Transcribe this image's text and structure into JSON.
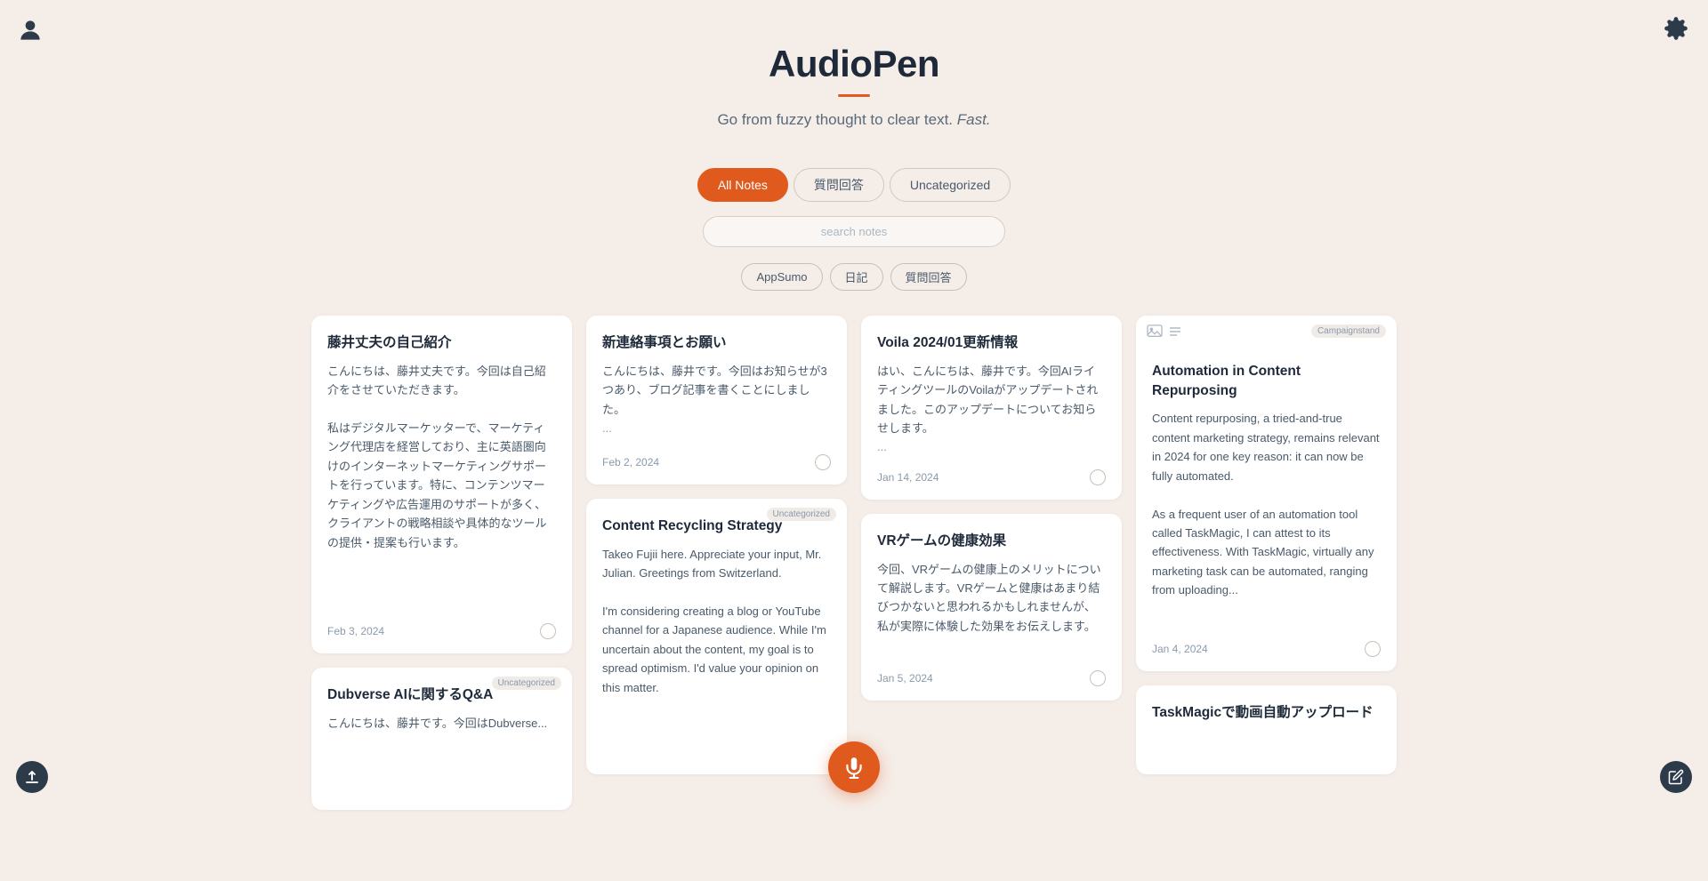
{
  "app": {
    "title": "AudioPen",
    "subtitle_normal": "Go from fuzzy thought to clear text.",
    "subtitle_italic": "Fast.",
    "divider_color": "#e05a1e"
  },
  "tabs": [
    {
      "id": "all",
      "label": "All Notes",
      "active": true
    },
    {
      "id": "qa",
      "label": "質問回答",
      "active": false
    },
    {
      "id": "uncategorized",
      "label": "Uncategorized",
      "active": false
    }
  ],
  "search": {
    "placeholder": "search notes"
  },
  "filter_tags": [
    {
      "id": "appsumo",
      "label": "AppSumo"
    },
    {
      "id": "diary",
      "label": "日記"
    },
    {
      "id": "qa",
      "label": "質問回答"
    }
  ],
  "notes": [
    {
      "id": "note-1",
      "title": "藤井丈夫の自己紹介",
      "body": "こんにちは、藤井丈夫です。今回は自己紹介をさせていただきます。\n\n私はデジタルマーケッターで、マーケティング代理店を経営しており、主に英語圏向けのインターネットマーケティングサポートを行っています。特に、コンテンツマーケティングや広告運用のサポートが多く、クライアントの戦略相談や具体的なツールの提供・提案も行います。",
      "date": "Feb 3, 2024",
      "category": null,
      "height": "tall"
    },
    {
      "id": "note-2",
      "title": "新連絡事項とお願い",
      "body": "こんにちは、藤井です。今回はお知らせが3つあり、ブログ記事を書くことにしました。\n\n...",
      "date": "Feb 2, 2024",
      "category": null,
      "height": "normal"
    },
    {
      "id": "note-3",
      "title": "Voila 2024/01更新情報",
      "body": "はい、こんにちは、藤井です。今回AIライティングツールのVoilaがアップデートされました。このアップデートについてお知らせします。\n\n...",
      "date": "Jan 14, 2024",
      "category": null,
      "height": "normal"
    },
    {
      "id": "note-4",
      "title": "Automation in Content Repurposing",
      "body": "Content repurposing, a tried-and-true content marketing strategy, remains relevant in 2024 for one key reason: it can now be fully automated.\n\nAs a frequent user of an automation tool called TaskMagic, I can attest to its effectiveness. With TaskMagic, virtually any marketing task can be automated, ranging from uploading...",
      "date": "Jan 4, 2024",
      "category": "Campaignstand",
      "height": "tall",
      "has_icons": true
    },
    {
      "id": "note-5",
      "title": "Content Recycling Strategy",
      "body": "Takeo Fujii here. Appreciate your input, Mr. Julian. Greetings from Switzerland.\n\nI'm considering creating a blog or YouTube channel for a Japanese audience. While I'm uncertain about the content, my goal is to spread optimism. I'd value your opinion on this matter.",
      "date": null,
      "category": "Uncategorized",
      "height": "medium"
    },
    {
      "id": "note-6",
      "title": "VRゲームの健康効果",
      "body": "今回、VRゲームの健康上のメリットについて解説します。VRゲームと健康はあまり結びつかないと思われるかもしれませんが、私が実際に体験した効果をお伝えします。",
      "date": "Jan 5, 2024",
      "category": null,
      "height": "medium"
    },
    {
      "id": "note-7",
      "title": "Dubverse AIに関するQ&A",
      "body": "こんにちは、藤井です。今回はDubverse...",
      "date": null,
      "category": "Uncategorized",
      "height": "partial"
    },
    {
      "id": "note-8",
      "title": "TaskMagicで動画自動アップロード",
      "body": "",
      "date": null,
      "category": null,
      "height": "partial"
    }
  ],
  "icons": {
    "user": "👤",
    "settings": "⚙",
    "upload": "↑",
    "edit": "✏",
    "mic": "🎤",
    "list": "☰",
    "image": "🖼"
  },
  "accent_color": "#e05a1e",
  "bg_color": "#f5ede8"
}
